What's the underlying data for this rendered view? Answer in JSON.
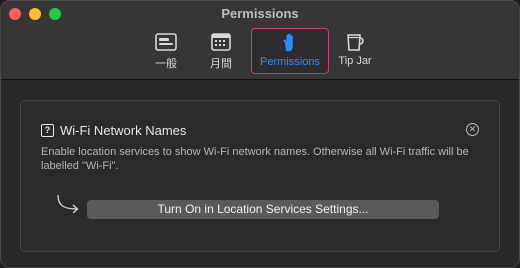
{
  "window": {
    "title": "Permissions"
  },
  "toolbar": {
    "tabs": [
      {
        "label": "一般",
        "icon": "general-icon",
        "selected": false
      },
      {
        "label": "月間",
        "icon": "calendar-icon",
        "selected": false
      },
      {
        "label": "Permissions",
        "icon": "hand-icon",
        "selected": true
      },
      {
        "label": "Tip Jar",
        "icon": "mug-icon",
        "selected": false
      }
    ]
  },
  "card": {
    "title": "Wi-Fi Network Names",
    "description": "Enable location services to show Wi-Fi network names. Otherwise all Wi-Fi traffic will be labelled \"Wi-Fi\".",
    "button_label": "Turn On in Location Services Settings...",
    "q_icon_glyph": "?",
    "close_glyph": "✕"
  },
  "colors": {
    "accent": "#2f8cff",
    "selection_border": "#d33a78"
  }
}
